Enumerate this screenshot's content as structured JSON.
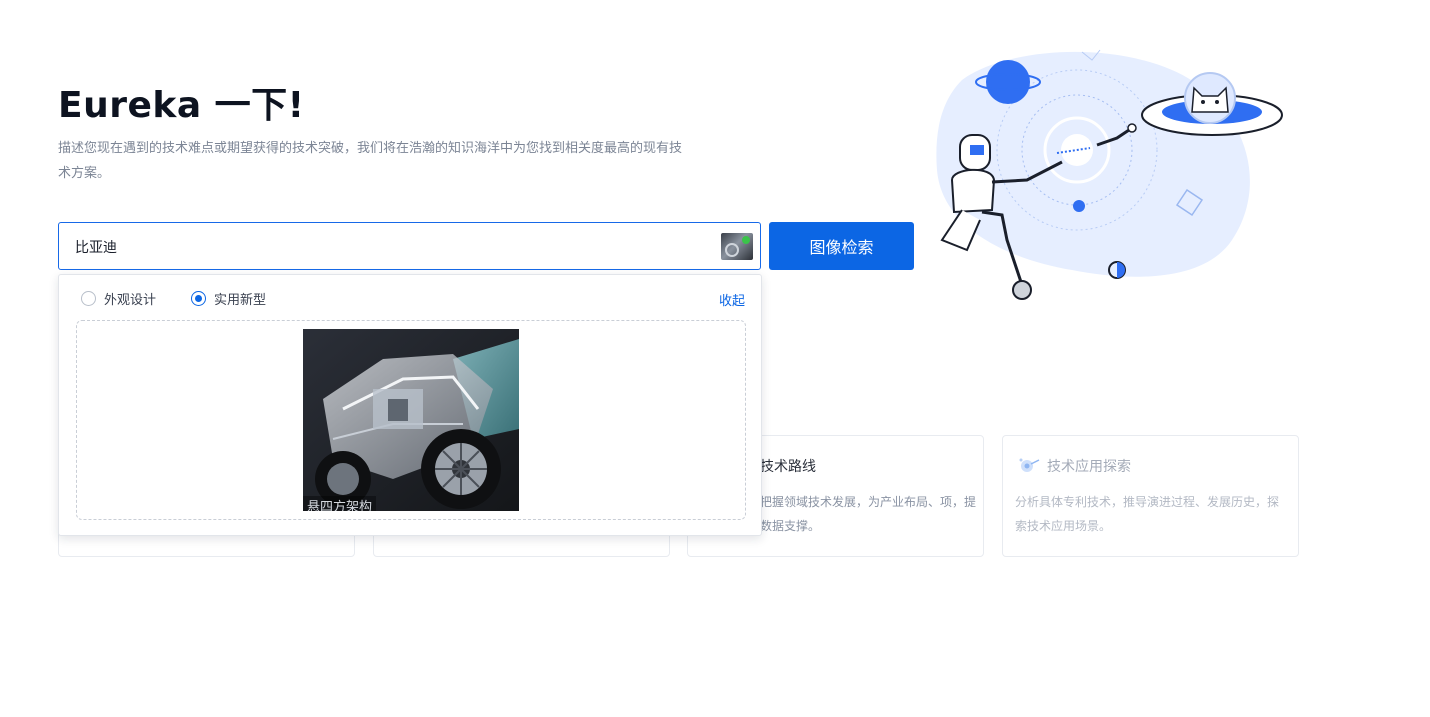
{
  "hero": {
    "title": "Eureka 一下!",
    "description": "描述您现在遇到的技术难点或期望获得的技术突破，我们将在浩瀚的知识海洋中为您找到相关度最高的现有技术方案。"
  },
  "search": {
    "value": "比亚迪",
    "button_label": "图像检索"
  },
  "dropdown": {
    "radio_options": [
      {
        "label": "外观设计",
        "checked": false
      },
      {
        "label": "实用新型",
        "checked": true
      }
    ],
    "collapse_label": "收起",
    "image_caption": "悬四方架构"
  },
  "cards": [
    {
      "title": "",
      "description": ""
    },
    {
      "title": "",
      "description": ""
    },
    {
      "title": "技术路线",
      "description": "员把握领域技术发展，为产业布局、项，提供数据支撑。"
    },
    {
      "title": "技术应用探索",
      "description": "分析具体专利技术，推导演进过程、发展历史，探索技术应用场景。"
    }
  ],
  "colors": {
    "accent": "#0c66e4",
    "status_dot": "#3bc44a"
  }
}
